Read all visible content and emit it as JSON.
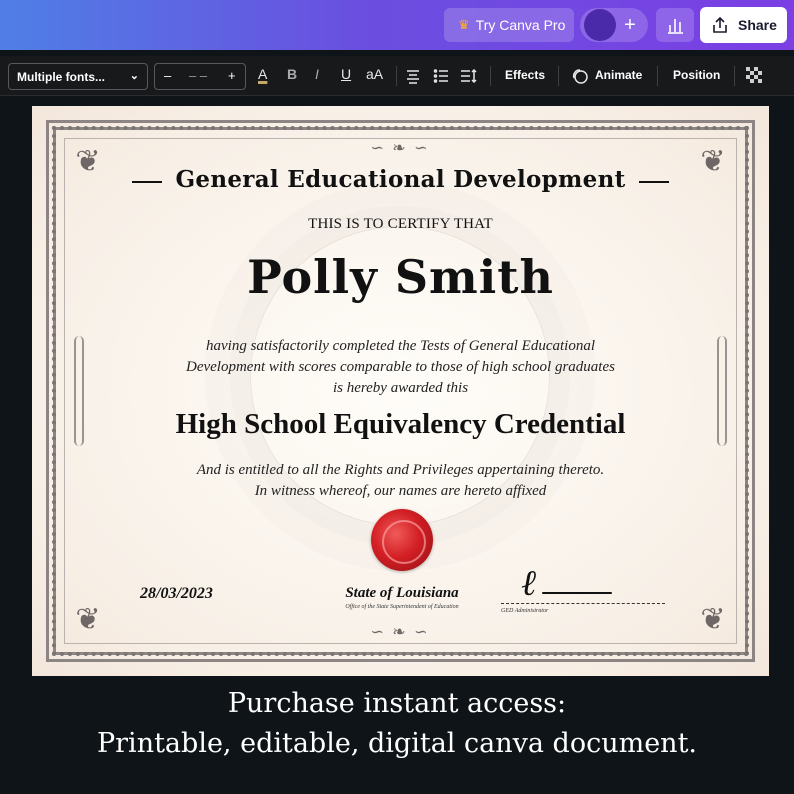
{
  "topbar": {
    "try_pro_label": "Try Canva Pro",
    "add_label": "+",
    "share_label": "Share"
  },
  "toolbar": {
    "font_family": "Multiple fonts...",
    "decrease": "–",
    "font_size": "– –",
    "increase": "+",
    "text_color": "A",
    "bold": "B",
    "italic": "I",
    "underline": "U",
    "case": "aA",
    "effects_label": "Effects",
    "animate_label": "Animate",
    "position_label": "Position"
  },
  "certificate": {
    "title": "General Educational Development",
    "certify_line": "THIS IS TO CERTIFY THAT",
    "recipient_name": "Polly Smith",
    "body_line_1": "having satisfactorily completed the Tests of General Educational",
    "body_line_2": "Development with scores comparable to those of high school graduates",
    "body_line_3": "is hereby awarded this",
    "credential": "High School Equivalency Credential",
    "rights_line_1": "And is entitled to all the Rights and Privileges appertaining thereto.",
    "rights_line_2": "In witness whereof, our names are hereto affixed",
    "date": "28/03/2023",
    "issuer": "State of Louisiana",
    "issuer_office": "Office of the State Superintendent of Education",
    "signature_role": "GED Administrator"
  },
  "caption": {
    "line_1": "Purchase instant access:",
    "line_2": "Printable, editable, digital canva document."
  },
  "colors": {
    "topbar_gradient_start": "#4f7fe6",
    "topbar_gradient_end": "#7b3fe4",
    "seal_red": "#d21f24",
    "background": "#0f1419",
    "paper": "#f8f0e7"
  },
  "icons": [
    "crown-icon",
    "avatar",
    "plus-icon",
    "insights-icon",
    "share-icon",
    "chevron-down-icon",
    "align-icon",
    "list-icon",
    "spacing-icon",
    "animate-icon",
    "transparency-icon"
  ]
}
